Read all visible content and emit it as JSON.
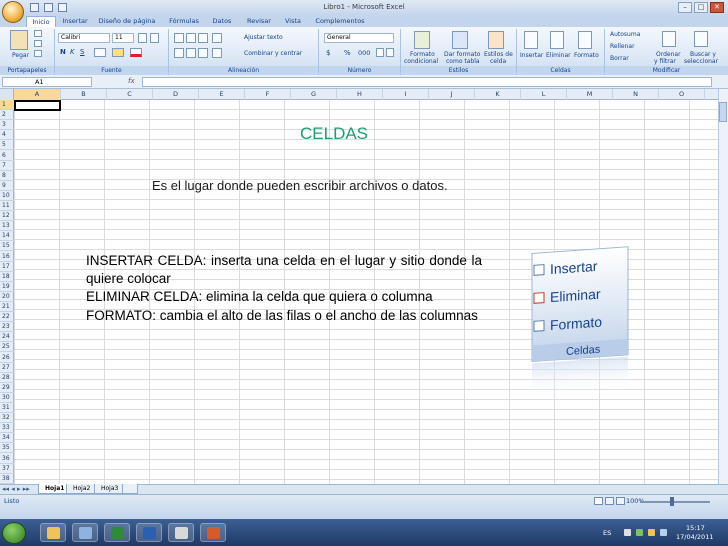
{
  "window": {
    "title": "Libro1 - Microsoft Excel",
    "min": "–",
    "max": "□",
    "close": "✕"
  },
  "tabs": [
    "Inicio",
    "Insertar",
    "Diseño de página",
    "Fórmulas",
    "Datos",
    "Revisar",
    "Vista",
    "Complementos"
  ],
  "ribbon": {
    "groups": [
      "Portapapeles",
      "Fuente",
      "Alineación",
      "Número",
      "Estilos",
      "Celdas",
      "Modificar"
    ],
    "paste_label": "Pegar",
    "font_name": "Calibri",
    "font_size": "11",
    "wrap_text": "Ajustar texto",
    "merge_center": "Combinar y centrar",
    "number_format": "General",
    "cond_format": [
      "Formato",
      "condicional"
    ],
    "table_format": [
      "Dar formato",
      "como tabla"
    ],
    "cell_styles": [
      "Estilos de",
      "celda"
    ],
    "insert": "Insertar",
    "delete": "Eliminar",
    "format": "Formato",
    "autosum": "Autosuma",
    "fill": "Rellenar",
    "clear": "Borrar",
    "sort": [
      "Ordenar",
      "y filtrar"
    ],
    "find": [
      "Buscar y",
      "seleccionar"
    ],
    "currency": "$",
    "percent": "%",
    "thousands": "000",
    "bold": "N",
    "italic": "K",
    "underline": "S"
  },
  "formula_bar": {
    "name_box": "A1",
    "fx": "fx",
    "value": ""
  },
  "columns": [
    "A",
    "B",
    "C",
    "D",
    "E",
    "F",
    "G",
    "H",
    "I",
    "J",
    "K",
    "L",
    "M",
    "N",
    "O"
  ],
  "rows": [
    "1",
    "2",
    "3",
    "4",
    "5",
    "6",
    "7",
    "8",
    "9",
    "10",
    "11",
    "12",
    "13",
    "14",
    "15",
    "16",
    "17",
    "18",
    "19",
    "20",
    "21",
    "22",
    "23",
    "24",
    "25",
    "26",
    "27",
    "28",
    "29",
    "30",
    "31",
    "32",
    "33",
    "34",
    "35",
    "36",
    "37",
    "38"
  ],
  "content": {
    "title": "CELDAS",
    "subtitle": "Es el lugar donde pueden escribir archivos o datos.",
    "paragraphs": [
      "INSERTAR CELDA: inserta una celda en el lugar y sitio donde la quiere colocar",
      "ELIMINAR CELDA: elimina la celda que quiera o columna",
      "FORMATO: cambia el alto de las filas o el ancho de las columnas"
    ]
  },
  "zoom_panel": {
    "insert": "Insertar",
    "delete": "Eliminar",
    "format": "Formato",
    "group": "Celdas"
  },
  "sheets": [
    "Hoja1",
    "Hoja2",
    "Hoja3"
  ],
  "status": {
    "text": "Listo",
    "zoom": "100%"
  },
  "taskbar": {
    "lang": "ES",
    "time": "15:17",
    "date": "17/04/2011"
  },
  "colors": {
    "accent": "#1aa06a",
    "ribbon": "#dbe7f5",
    "taskbar": "#1f3a66"
  }
}
